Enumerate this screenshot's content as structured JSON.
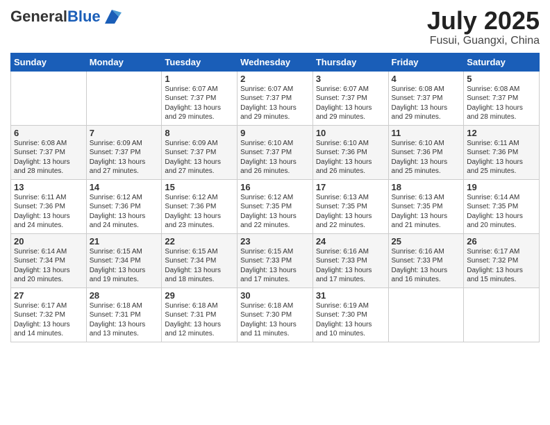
{
  "logo": {
    "general": "General",
    "blue": "Blue"
  },
  "title": "July 2025",
  "location": "Fusui, Guangxi, China",
  "days_of_week": [
    "Sunday",
    "Monday",
    "Tuesday",
    "Wednesday",
    "Thursday",
    "Friday",
    "Saturday"
  ],
  "weeks": [
    [
      {
        "day": "",
        "sunrise": "",
        "sunset": "",
        "daylight": ""
      },
      {
        "day": "",
        "sunrise": "",
        "sunset": "",
        "daylight": ""
      },
      {
        "day": "1",
        "sunrise": "Sunrise: 6:07 AM",
        "sunset": "Sunset: 7:37 PM",
        "daylight": "Daylight: 13 hours and 29 minutes."
      },
      {
        "day": "2",
        "sunrise": "Sunrise: 6:07 AM",
        "sunset": "Sunset: 7:37 PM",
        "daylight": "Daylight: 13 hours and 29 minutes."
      },
      {
        "day": "3",
        "sunrise": "Sunrise: 6:07 AM",
        "sunset": "Sunset: 7:37 PM",
        "daylight": "Daylight: 13 hours and 29 minutes."
      },
      {
        "day": "4",
        "sunrise": "Sunrise: 6:08 AM",
        "sunset": "Sunset: 7:37 PM",
        "daylight": "Daylight: 13 hours and 29 minutes."
      },
      {
        "day": "5",
        "sunrise": "Sunrise: 6:08 AM",
        "sunset": "Sunset: 7:37 PM",
        "daylight": "Daylight: 13 hours and 28 minutes."
      }
    ],
    [
      {
        "day": "6",
        "sunrise": "Sunrise: 6:08 AM",
        "sunset": "Sunset: 7:37 PM",
        "daylight": "Daylight: 13 hours and 28 minutes."
      },
      {
        "day": "7",
        "sunrise": "Sunrise: 6:09 AM",
        "sunset": "Sunset: 7:37 PM",
        "daylight": "Daylight: 13 hours and 27 minutes."
      },
      {
        "day": "8",
        "sunrise": "Sunrise: 6:09 AM",
        "sunset": "Sunset: 7:37 PM",
        "daylight": "Daylight: 13 hours and 27 minutes."
      },
      {
        "day": "9",
        "sunrise": "Sunrise: 6:10 AM",
        "sunset": "Sunset: 7:37 PM",
        "daylight": "Daylight: 13 hours and 26 minutes."
      },
      {
        "day": "10",
        "sunrise": "Sunrise: 6:10 AM",
        "sunset": "Sunset: 7:36 PM",
        "daylight": "Daylight: 13 hours and 26 minutes."
      },
      {
        "day": "11",
        "sunrise": "Sunrise: 6:10 AM",
        "sunset": "Sunset: 7:36 PM",
        "daylight": "Daylight: 13 hours and 25 minutes."
      },
      {
        "day": "12",
        "sunrise": "Sunrise: 6:11 AM",
        "sunset": "Sunset: 7:36 PM",
        "daylight": "Daylight: 13 hours and 25 minutes."
      }
    ],
    [
      {
        "day": "13",
        "sunrise": "Sunrise: 6:11 AM",
        "sunset": "Sunset: 7:36 PM",
        "daylight": "Daylight: 13 hours and 24 minutes."
      },
      {
        "day": "14",
        "sunrise": "Sunrise: 6:12 AM",
        "sunset": "Sunset: 7:36 PM",
        "daylight": "Daylight: 13 hours and 24 minutes."
      },
      {
        "day": "15",
        "sunrise": "Sunrise: 6:12 AM",
        "sunset": "Sunset: 7:36 PM",
        "daylight": "Daylight: 13 hours and 23 minutes."
      },
      {
        "day": "16",
        "sunrise": "Sunrise: 6:12 AM",
        "sunset": "Sunset: 7:35 PM",
        "daylight": "Daylight: 13 hours and 22 minutes."
      },
      {
        "day": "17",
        "sunrise": "Sunrise: 6:13 AM",
        "sunset": "Sunset: 7:35 PM",
        "daylight": "Daylight: 13 hours and 22 minutes."
      },
      {
        "day": "18",
        "sunrise": "Sunrise: 6:13 AM",
        "sunset": "Sunset: 7:35 PM",
        "daylight": "Daylight: 13 hours and 21 minutes."
      },
      {
        "day": "19",
        "sunrise": "Sunrise: 6:14 AM",
        "sunset": "Sunset: 7:35 PM",
        "daylight": "Daylight: 13 hours and 20 minutes."
      }
    ],
    [
      {
        "day": "20",
        "sunrise": "Sunrise: 6:14 AM",
        "sunset": "Sunset: 7:34 PM",
        "daylight": "Daylight: 13 hours and 20 minutes."
      },
      {
        "day": "21",
        "sunrise": "Sunrise: 6:15 AM",
        "sunset": "Sunset: 7:34 PM",
        "daylight": "Daylight: 13 hours and 19 minutes."
      },
      {
        "day": "22",
        "sunrise": "Sunrise: 6:15 AM",
        "sunset": "Sunset: 7:34 PM",
        "daylight": "Daylight: 13 hours and 18 minutes."
      },
      {
        "day": "23",
        "sunrise": "Sunrise: 6:15 AM",
        "sunset": "Sunset: 7:33 PM",
        "daylight": "Daylight: 13 hours and 17 minutes."
      },
      {
        "day": "24",
        "sunrise": "Sunrise: 6:16 AM",
        "sunset": "Sunset: 7:33 PM",
        "daylight": "Daylight: 13 hours and 17 minutes."
      },
      {
        "day": "25",
        "sunrise": "Sunrise: 6:16 AM",
        "sunset": "Sunset: 7:33 PM",
        "daylight": "Daylight: 13 hours and 16 minutes."
      },
      {
        "day": "26",
        "sunrise": "Sunrise: 6:17 AM",
        "sunset": "Sunset: 7:32 PM",
        "daylight": "Daylight: 13 hours and 15 minutes."
      }
    ],
    [
      {
        "day": "27",
        "sunrise": "Sunrise: 6:17 AM",
        "sunset": "Sunset: 7:32 PM",
        "daylight": "Daylight: 13 hours and 14 minutes."
      },
      {
        "day": "28",
        "sunrise": "Sunrise: 6:18 AM",
        "sunset": "Sunset: 7:31 PM",
        "daylight": "Daylight: 13 hours and 13 minutes."
      },
      {
        "day": "29",
        "sunrise": "Sunrise: 6:18 AM",
        "sunset": "Sunset: 7:31 PM",
        "daylight": "Daylight: 13 hours and 12 minutes."
      },
      {
        "day": "30",
        "sunrise": "Sunrise: 6:18 AM",
        "sunset": "Sunset: 7:30 PM",
        "daylight": "Daylight: 13 hours and 11 minutes."
      },
      {
        "day": "31",
        "sunrise": "Sunrise: 6:19 AM",
        "sunset": "Sunset: 7:30 PM",
        "daylight": "Daylight: 13 hours and 10 minutes."
      },
      {
        "day": "",
        "sunrise": "",
        "sunset": "",
        "daylight": ""
      },
      {
        "day": "",
        "sunrise": "",
        "sunset": "",
        "daylight": ""
      }
    ]
  ]
}
